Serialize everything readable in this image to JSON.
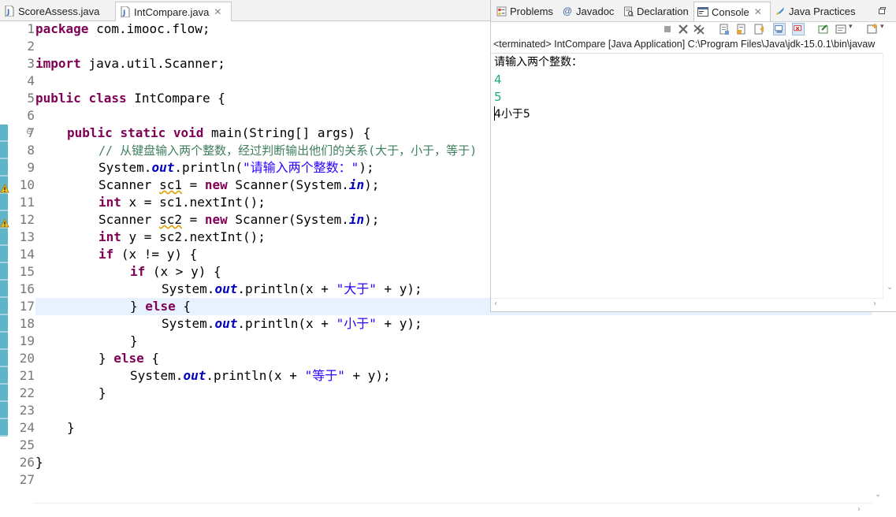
{
  "editor": {
    "tabs": [
      {
        "label": "ScoreAssess.java",
        "active": false
      },
      {
        "label": "IntCompare.java",
        "active": true
      }
    ],
    "close_glyph": "✕",
    "lines": [
      {
        "n": "1"
      },
      {
        "n": "2"
      },
      {
        "n": "3"
      },
      {
        "n": "4"
      },
      {
        "n": "5"
      },
      {
        "n": "6"
      },
      {
        "n": "7"
      },
      {
        "n": "8"
      },
      {
        "n": "9"
      },
      {
        "n": "10"
      },
      {
        "n": "11"
      },
      {
        "n": "12"
      },
      {
        "n": "13"
      },
      {
        "n": "14"
      },
      {
        "n": "15"
      },
      {
        "n": "16"
      },
      {
        "n": "17"
      },
      {
        "n": "18"
      },
      {
        "n": "19"
      },
      {
        "n": "20"
      },
      {
        "n": "21"
      },
      {
        "n": "22"
      },
      {
        "n": "23"
      },
      {
        "n": "24"
      },
      {
        "n": "25"
      },
      {
        "n": "26"
      },
      {
        "n": "27"
      }
    ],
    "code": {
      "l1_kw": "package",
      "l1_rest": " com.imooc.flow;",
      "l3_kw": "import",
      "l3_rest": " java.util.Scanner;",
      "l5_kw1": "public",
      "l5_kw2": "class",
      "l5_rest": " IntCompare {",
      "l7_kw1": "public",
      "l7_kw2": "static",
      "l7_kw3": "void",
      "l7_rest": " main(String[] args) {",
      "l8_comment": "// 从键盘输入两个整数，经过判断输出他们的关系(大于，小于，等于)",
      "l9_a": "System.",
      "l9_fld": "out",
      "l9_b": ".println(",
      "l9_str": "\"请输入两个整数：\"",
      "l9_c": ");",
      "l10_a": "Scanner ",
      "l10_var": "sc1",
      "l10_b": " = ",
      "l10_kw": "new",
      "l10_c": " Scanner(System.",
      "l10_fld": "in",
      "l10_d": ");",
      "l11_kw": "int",
      "l11_rest": " x = sc1.nextInt();",
      "l12_a": "Scanner ",
      "l12_var": "sc2",
      "l12_b": " = ",
      "l12_kw": "new",
      "l12_c": " Scanner(System.",
      "l12_fld": "in",
      "l12_d": ");",
      "l13_kw": "int",
      "l13_rest": " y = sc2.nextInt();",
      "l14_kw": "if",
      "l14_rest": " (x != y) {",
      "l15_kw": "if",
      "l15_rest": " (x > y) {",
      "l16_a": "System.",
      "l16_fld": "out",
      "l16_b": ".println(x + ",
      "l16_str": "\"大于\"",
      "l16_c": " + y);",
      "l17_a": "} ",
      "l17_kw": "else",
      "l17_b": " {",
      "l18_a": "System.",
      "l18_fld": "out",
      "l18_b": ".println(x + ",
      "l18_str": "\"小于\"",
      "l18_c": " + y);",
      "l19": "}",
      "l20_a": "} ",
      "l20_kw": "else",
      "l20_b": " {",
      "l21_a": "System.",
      "l21_fld": "out",
      "l21_b": ".println(x + ",
      "l21_str": "\"等于\"",
      "l21_c": " + y);",
      "l22": "}",
      "l24": "}",
      "l26": "}"
    }
  },
  "views": {
    "tabs": [
      {
        "label": "Problems",
        "icon": "problems-icon"
      },
      {
        "label": "Javadoc",
        "icon": "javadoc-icon",
        "glyph": "@"
      },
      {
        "label": "Declaration",
        "icon": "declaration-icon"
      },
      {
        "label": "Console",
        "icon": "console-icon",
        "active": true
      },
      {
        "label": "Java Practices",
        "icon": "java-practices-icon"
      }
    ],
    "close_glyph": "✕"
  },
  "console": {
    "status": "<terminated> IntCompare [Java Application] C:\\Program Files\\Java\\jdk-15.0.1\\bin\\javaw",
    "output": [
      {
        "text": "请输入两个整数：",
        "kind": "stdout"
      },
      {
        "text": "4",
        "kind": "stdin"
      },
      {
        "text": "5",
        "kind": "stdin"
      },
      {
        "text": "4小于5",
        "kind": "stdout"
      }
    ]
  },
  "colors": {
    "keyword": "#7f0055",
    "string": "#2a00ff",
    "comment": "#3f7f5f",
    "field": "#0000c0",
    "stdin": "#1faa82",
    "current_line": "#e8f2fe"
  }
}
